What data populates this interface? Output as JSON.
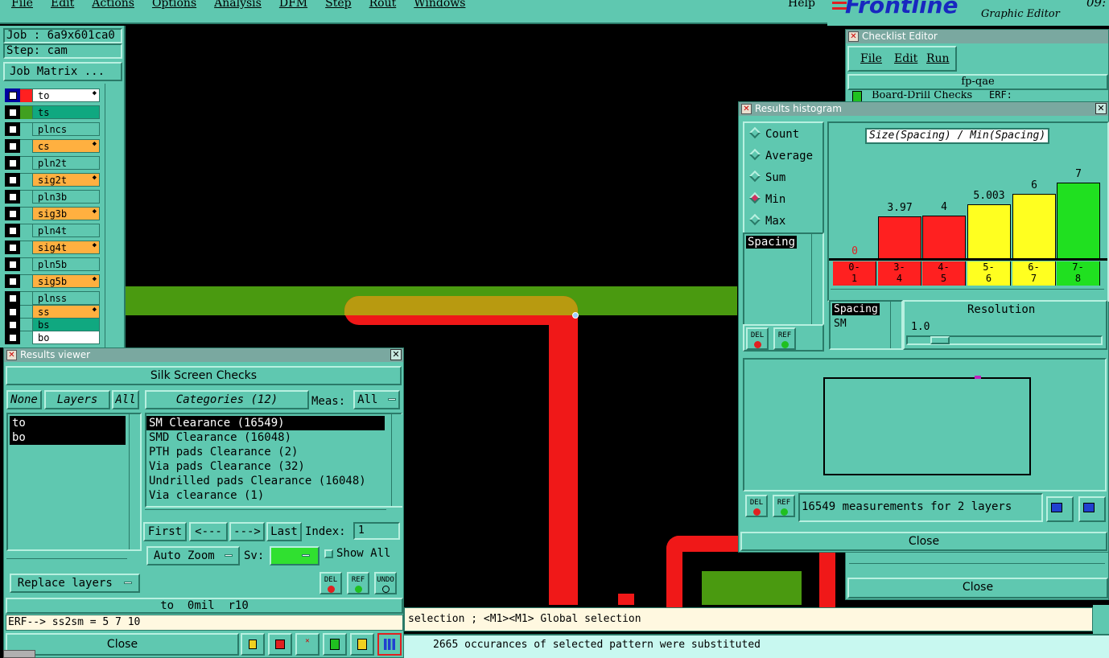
{
  "menubar": {
    "items": [
      "File",
      "Edit",
      "Actions",
      "Options",
      "Analysis",
      "DFM",
      "Step",
      "Rout",
      "Windows"
    ],
    "help": "Help"
  },
  "brand": {
    "logo": "Frontline",
    "subtitle": "Graphic Editor",
    "clock": "09:"
  },
  "left_panel": {
    "job_label": "Job : 6a9x601ca0",
    "step_label": "Step: cam",
    "job_matrix_button": "Job Matrix ...",
    "layers": [
      {
        "name": "to",
        "color": "#ff2020",
        "flag": "#ffffff",
        "box": "#0000a0",
        "arrow": true
      },
      {
        "name": "ts",
        "color": "#40a020",
        "flag": "#10a880",
        "box": "#000000",
        "arrow": false
      },
      {
        "name": "plncs",
        "color": "#5fc8b0",
        "flag": "#5fc8b0",
        "box": "#000000",
        "arrow": false
      },
      {
        "name": "cs",
        "color": "#5fc8b0",
        "flag": "#ffb040",
        "box": "#000000",
        "arrow": true
      },
      {
        "name": "pln2t",
        "color": "#5fc8b0",
        "flag": "#5fc8b0",
        "box": "#000000",
        "arrow": false
      },
      {
        "name": "sig2t",
        "color": "#5fc8b0",
        "flag": "#ffb040",
        "box": "#000000",
        "arrow": true
      },
      {
        "name": "pln3b",
        "color": "#5fc8b0",
        "flag": "#5fc8b0",
        "box": "#000000",
        "arrow": false
      },
      {
        "name": "sig3b",
        "color": "#5fc8b0",
        "flag": "#ffb040",
        "box": "#000000",
        "arrow": true
      },
      {
        "name": "pln4t",
        "color": "#5fc8b0",
        "flag": "#5fc8b0",
        "box": "#000000",
        "arrow": false
      },
      {
        "name": "sig4t",
        "color": "#5fc8b0",
        "flag": "#ffb040",
        "box": "#000000",
        "arrow": true
      },
      {
        "name": "pln5b",
        "color": "#5fc8b0",
        "flag": "#5fc8b0",
        "box": "#000000",
        "arrow": false
      },
      {
        "name": "sig5b",
        "color": "#5fc8b0",
        "flag": "#ffb040",
        "box": "#000000",
        "arrow": true
      },
      {
        "name": "plnss",
        "color": "#5fc8b0",
        "flag": "#5fc8b0",
        "box": "#000000",
        "arrow": false
      },
      {
        "name": "ss",
        "color": "#5fc8b0",
        "flag": "#ffb040",
        "box": "#000000",
        "arrow": true
      },
      {
        "name": "bs",
        "color": "#5fc8b0",
        "flag": "#10a880",
        "box": "#000000",
        "arrow": false
      },
      {
        "name": "bo",
        "color": "#5fc8b0",
        "flag": "#ffffff",
        "box": "#000000",
        "arrow": false
      }
    ]
  },
  "results_viewer": {
    "title": "Results viewer",
    "header": "Silk Screen Checks",
    "none_btn": "None",
    "layers_btn": "Layers",
    "all_btn": "All",
    "layer_items": [
      "to",
      "bo"
    ],
    "categories_btn": "Categories (12)",
    "meas_label": "Meas:",
    "meas_value": "All",
    "categories": [
      "SM Clearance (16549)",
      "SMD Clearance (16048)",
      "PTH pads Clearance (2)",
      "Via pads Clearance (32)",
      "Undrilled pads Clearance (16048)",
      "Via clearance (1)"
    ],
    "first_btn": "First",
    "prev_btn": "<---",
    "next_btn": "--->",
    "last_btn": "Last",
    "index_label": "Index:",
    "index_value": "1",
    "autozoom_btn": "Auto Zoom",
    "sv_label": "Sv:",
    "show_all_label": "Show All",
    "replace_btn": "Replace layers",
    "del_label": "DEL",
    "ref_label": "REF",
    "undo_label": "UNDO",
    "status_line": "to  0mil  r10",
    "erf_line": "ERF--> ss2sm = 5 7 10",
    "close_btn": "Close"
  },
  "checklist_editor": {
    "title": "Checklist Editor",
    "menu": [
      "File",
      "Edit",
      "Run"
    ],
    "name": "fp-qae",
    "row_partial": "Board-Drill Checks",
    "row_partial_erf": "ERF:",
    "close_btn": "Close"
  },
  "histogram": {
    "title": "Results histogram",
    "modes": [
      "Count",
      "Average",
      "Sum",
      "Min",
      "Max"
    ],
    "selected_mode": "Min",
    "chart_title": "Size(Spacing) / Min(Spacing)",
    "list_item": "Spacing",
    "list2": [
      "Spacing",
      "SM"
    ],
    "resolution_label": "Resolution",
    "resolution_value": "1.0",
    "measurements_text": "16549 measurements for 2 layers",
    "close_btn": "Close",
    "del_label": "DEL",
    "ref_label": "REF"
  },
  "chart_data": {
    "type": "bar",
    "title": "Size(Spacing) / Min(Spacing)",
    "categories": [
      "0-1",
      "3-4",
      "4-5",
      "5-6",
      "6-7",
      "7-8"
    ],
    "values": [
      0,
      3.97,
      4,
      5.003,
      6,
      7
    ],
    "value_labels": [
      "0",
      "3.97",
      "4",
      "5.003",
      "6",
      "7"
    ],
    "colors": [
      "#ff2020",
      "#ff2020",
      "#ff2020",
      "#ffff20",
      "#ffff20",
      "#20e020"
    ],
    "ylim": [
      0,
      7
    ]
  },
  "console": {
    "line1": "selection ; <M1><M1> Global selection",
    "line2": "2665 occurances of selected pattern were substituted"
  }
}
